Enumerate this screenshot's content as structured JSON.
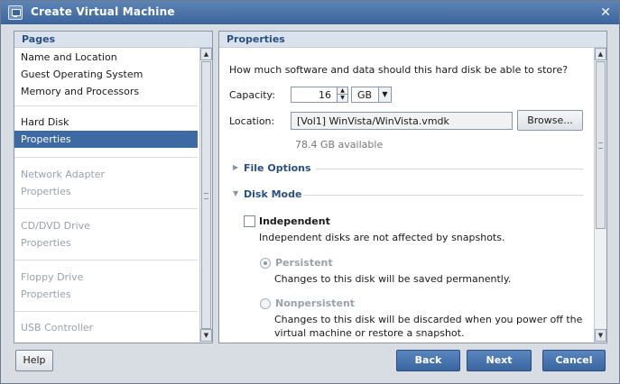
{
  "window": {
    "title": "Create Virtual Machine",
    "close_icon": "close-icon",
    "app_icon": "vm-window-icon"
  },
  "pages": {
    "header": "Pages",
    "groups": [
      {
        "items": [
          {
            "label": "Name and Location",
            "state": "normal"
          },
          {
            "label": "Guest Operating System",
            "state": "normal"
          },
          {
            "label": "Memory and Processors",
            "state": "normal"
          }
        ]
      },
      {
        "items": [
          {
            "label": "Hard Disk",
            "state": "normal"
          },
          {
            "label": "Properties",
            "state": "selected"
          }
        ]
      },
      {
        "items": [
          {
            "label": "Network Adapter",
            "state": "disabled"
          },
          {
            "label": "Properties",
            "state": "disabled"
          }
        ]
      },
      {
        "items": [
          {
            "label": "CD/DVD Drive",
            "state": "disabled"
          },
          {
            "label": "Properties",
            "state": "disabled"
          }
        ]
      },
      {
        "items": [
          {
            "label": "Floppy Drive",
            "state": "disabled"
          },
          {
            "label": "Properties",
            "state": "disabled"
          }
        ]
      },
      {
        "items": [
          {
            "label": "USB Controller",
            "state": "disabled"
          }
        ]
      }
    ]
  },
  "properties": {
    "header": "Properties",
    "question": "How much software and data should this hard disk be able to store?",
    "capacity_label": "Capacity:",
    "capacity_value": "16",
    "capacity_unit": "GB",
    "location_label": "Location:",
    "location_value": "[Vol1] WinVista/WinVista.vmdk",
    "browse_label": "Browse...",
    "available": "78.4 GB available",
    "file_options_label": "File Options",
    "disk_mode_label": "Disk Mode",
    "independent_label": "Independent",
    "independent_checked": false,
    "independent_desc": "Independent disks are not affected by snapshots.",
    "persistent_label": "Persistent",
    "persistent_selected": true,
    "persistent_desc": "Changes to this disk will be saved permanently.",
    "nonpersistent_label": "Nonpersistent",
    "nonpersistent_desc_line1": "Changes to this disk will be discarded when you power off the",
    "nonpersistent_desc_line2": "virtual machine or restore a snapshot."
  },
  "buttons": {
    "help": "Help",
    "back": "Back",
    "next": "Next",
    "cancel": "Cancel"
  },
  "colors": {
    "titlebar": "#3b649c",
    "selection": "#3d6aa3",
    "section_header": "#2b4f7f",
    "primary_button": "#3a66a0"
  }
}
